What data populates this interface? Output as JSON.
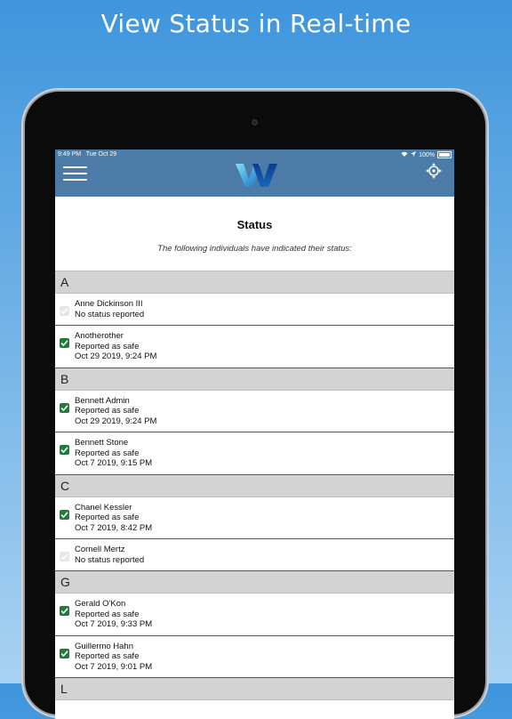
{
  "headline": "View Status in Real-time",
  "statusbar": {
    "time": "9:49 PM",
    "date": "Tue Oct 29",
    "battery": "100%"
  },
  "appbar": {
    "logo": "W",
    "menu_icon": "hamburger-icon",
    "locate_icon": "crosshair-icon"
  },
  "page": {
    "title": "Status",
    "subtitle": "The following individuals have indicated their status:"
  },
  "sections": [
    {
      "letter": "A",
      "people": [
        {
          "name": "Anne Dickinson III",
          "status": "No status reported",
          "time": "",
          "checked": false
        },
        {
          "name": "Anotherother",
          "status": "Reported as safe",
          "time": "Oct 29 2019, 9:24 PM",
          "checked": true
        }
      ]
    },
    {
      "letter": "B",
      "people": [
        {
          "name": "Bennett Admin",
          "status": "Reported as safe",
          "time": "Oct 29 2019, 9:24 PM",
          "checked": true
        },
        {
          "name": "Bennett Stone",
          "status": "Reported as safe",
          "time": "Oct 7 2019, 9:15 PM",
          "checked": true
        }
      ]
    },
    {
      "letter": "C",
      "people": [
        {
          "name": "Chanel Kessler",
          "status": "Reported as safe",
          "time": "Oct 7 2019, 8:42 PM",
          "checked": true
        },
        {
          "name": "Cornell Mertz",
          "status": "No status reported",
          "time": "",
          "checked": false
        }
      ]
    },
    {
      "letter": "G",
      "people": [
        {
          "name": "Gerald O'Kon",
          "status": "Reported as safe",
          "time": "Oct 7 2019, 9:33 PM",
          "checked": true
        },
        {
          "name": "Guillermo Hahn",
          "status": "Reported as safe",
          "time": "Oct 7 2019, 9:01 PM",
          "checked": true
        }
      ]
    },
    {
      "letter": "L",
      "people": []
    }
  ],
  "colors": {
    "accent": "#4c7ba7",
    "check": "#1e7d3a",
    "section": "#d3d3d3"
  }
}
